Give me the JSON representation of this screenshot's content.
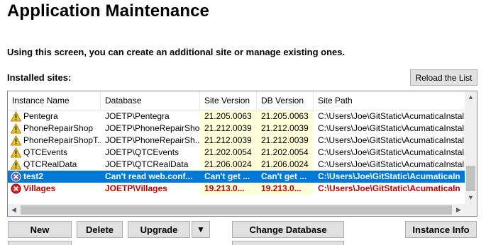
{
  "page": {
    "title": "Application Maintenance",
    "intro": "Using this screen, you can create an additional site or manage existing ones.",
    "installed_label": "Installed sites:",
    "reload_label": "Reload the List"
  },
  "columns": [
    "Instance Name",
    "Database",
    "Site Version",
    "DB Version",
    "Site Path"
  ],
  "rows": [
    {
      "icon": "warning-icon",
      "name": "Pentegra",
      "database": "JOETP\\Pentegra",
      "site_version": "21.205.0063",
      "db_version": "21.205.0063",
      "path": "C:\\Users\\Joe\\GitStatic\\AcumaticaInstallatio",
      "state": "normal"
    },
    {
      "icon": "warning-icon",
      "name": "PhoneRepairShop",
      "database": "JOETP\\PhoneRepairShop",
      "site_version": "21.212.0039",
      "db_version": "21.212.0039",
      "path": "C:\\Users\\Joe\\GitStatic\\AcumaticaInstallatio",
      "state": "normal"
    },
    {
      "icon": "warning-icon",
      "name": "PhoneRepairShopT...",
      "database": "JOETP\\PhoneRepairSh...",
      "site_version": "21.212.0039",
      "db_version": "21.212.0039",
      "path": "C:\\Users\\Joe\\GitStatic\\AcumaticaInstallatio",
      "state": "normal"
    },
    {
      "icon": "warning-icon",
      "name": "QTCEvents",
      "database": "JOETP\\QTCEvents",
      "site_version": "21.202.0054",
      "db_version": "21.202.0054",
      "path": "C:\\Users\\Joe\\GitStatic\\AcumaticaInstallatio",
      "state": "normal"
    },
    {
      "icon": "warning-icon",
      "name": "QTCRealData",
      "database": "JOETP\\QTCRealData",
      "site_version": "21.206.0024",
      "db_version": "21.206.0024",
      "path": "C:\\Users\\Joe\\GitStatic\\AcumaticaInstallatio",
      "state": "normal"
    },
    {
      "icon": "unknown-icon",
      "name": "test2",
      "database": "Can't read web.conf...",
      "site_version": "Can't get ...",
      "db_version": "Can't get ...",
      "path": "C:\\Users\\Joe\\GitStatic\\AcumaticaIn",
      "state": "selected"
    },
    {
      "icon": "error-icon",
      "name": "Villages",
      "database": "JOETP\\Villages",
      "site_version": "19.213.0...",
      "db_version": "19.213.0...",
      "path": "C:\\Users\\Joe\\GitStatic\\AcumaticaIn",
      "state": "error"
    }
  ],
  "buttons": {
    "new": "New",
    "delete": "Delete",
    "upgrade": "Upgrade",
    "change_database": "Change Database",
    "instance_info": "Instance Info"
  },
  "colors": {
    "selection": "#0078d7",
    "version_highlight": "#ffffd9",
    "error_text": "#c00000",
    "button_face": "#e1e1e1"
  }
}
